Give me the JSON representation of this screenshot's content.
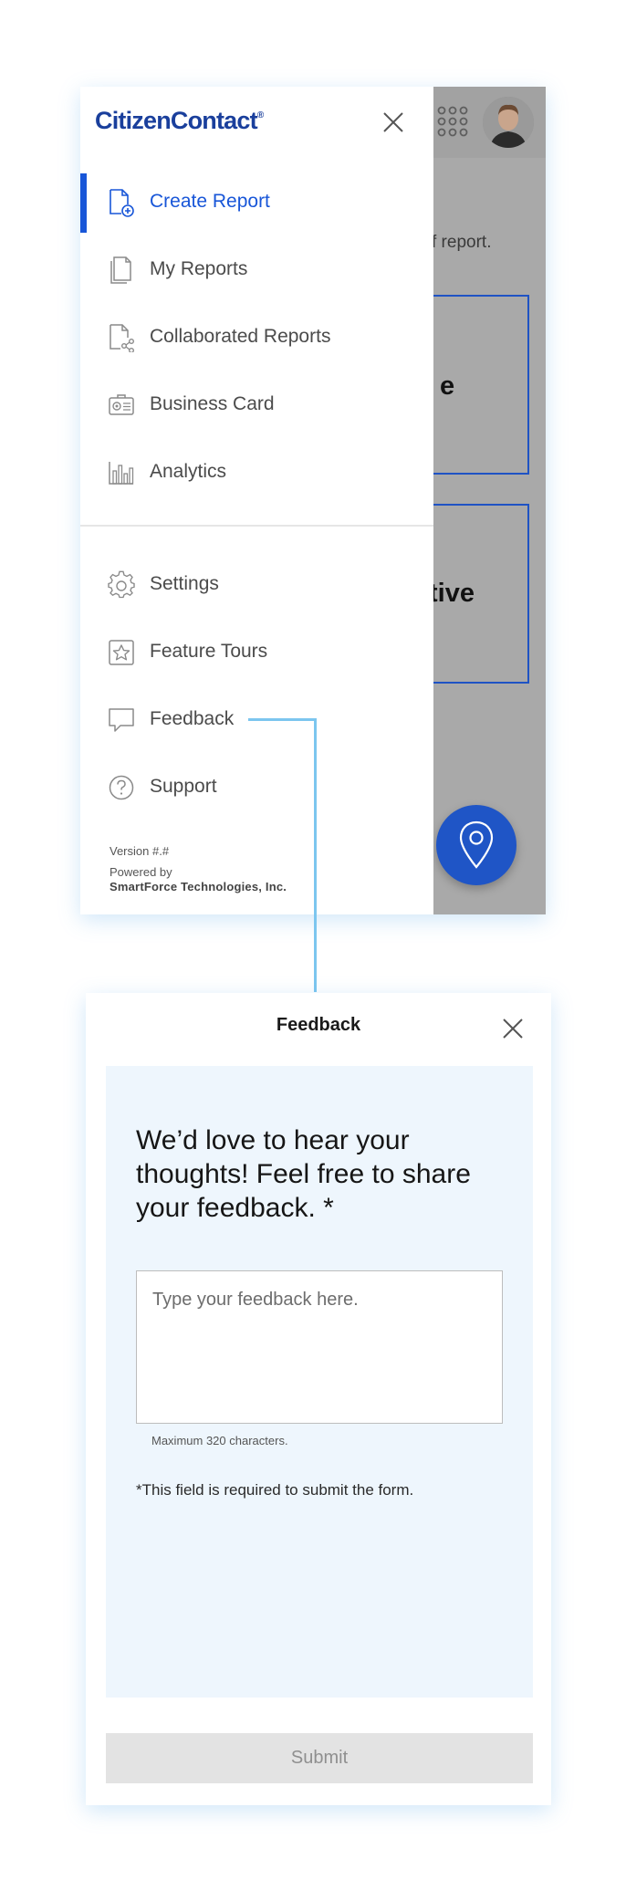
{
  "app": {
    "brand": "CitizenContact",
    "brand_mark": "®"
  },
  "background_screen": {
    "partial_text": "f report.",
    "card_1_partial_label": "e",
    "card_2_partial_label": "tive",
    "accent_color": "#1f53c4"
  },
  "menu": {
    "primary_items": [
      {
        "label": "Create Report",
        "icon": "create-report-icon",
        "active": true
      },
      {
        "label": "My Reports",
        "icon": "my-reports-icon",
        "active": false
      },
      {
        "label": "Collaborated Reports",
        "icon": "collaborated-reports-icon",
        "active": false
      },
      {
        "label": "Business Card",
        "icon": "business-card-icon",
        "active": false
      },
      {
        "label": "Analytics",
        "icon": "analytics-icon",
        "active": false
      }
    ],
    "secondary_items": [
      {
        "label": "Settings",
        "icon": "gear-icon"
      },
      {
        "label": "Feature Tours",
        "icon": "star-icon"
      },
      {
        "label": "Feedback",
        "icon": "chat-bubble-icon"
      },
      {
        "label": "Support",
        "icon": "question-icon"
      }
    ],
    "version": "Version #.#",
    "powered_by": "Powered by",
    "company": "SmartForce Technologies, Inc.",
    "active_color": "#1856d8"
  },
  "feedback": {
    "title": "Feedback",
    "heading": "We’d love to hear your thoughts! Feel free to share your feedback. *",
    "placeholder": "Type your feedback here.",
    "value": "",
    "max_note": "Maximum 320 characters.",
    "required_note": "*This field is required to submit the form.",
    "submit_label": "Submit",
    "panel_color": "#eef6fd",
    "connector_color": "#7cc6ef"
  }
}
